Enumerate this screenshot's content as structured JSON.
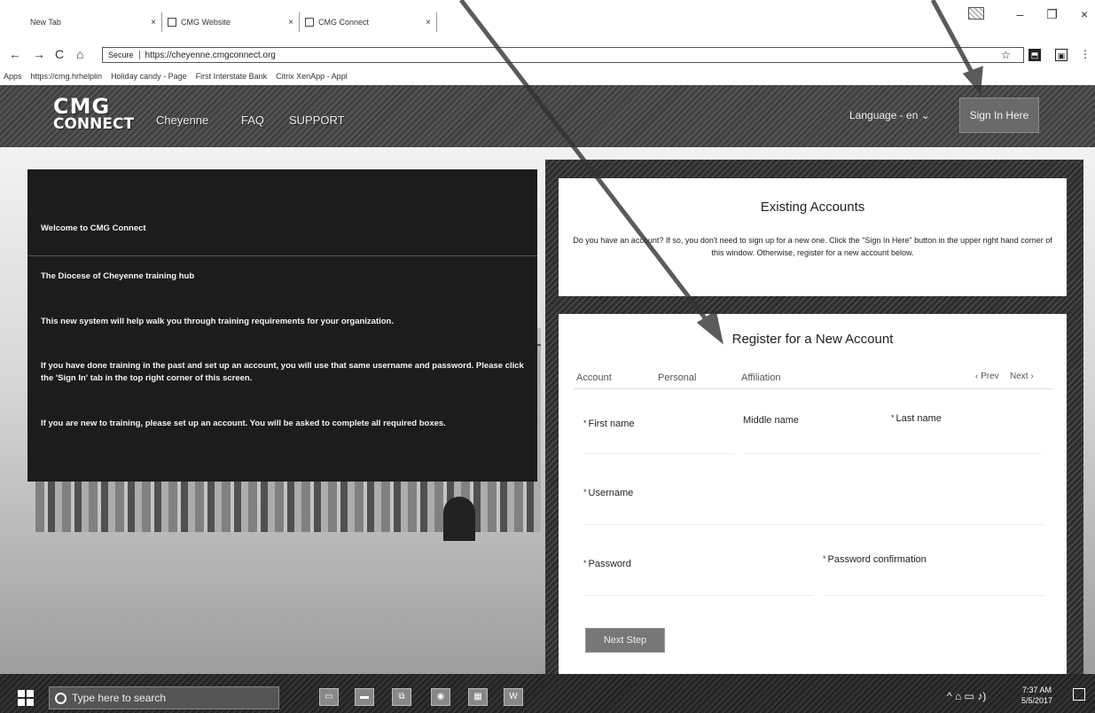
{
  "browser": {
    "tabs": [
      {
        "label": "New Tab"
      },
      {
        "label": "CMG Website"
      },
      {
        "label": "CMG Connect"
      }
    ],
    "tab_close_glyph": "×",
    "window_controls": {
      "minimize": "–",
      "maximize": "❐",
      "close": "×"
    },
    "nav": {
      "back": "←",
      "forward": "→",
      "reload": "C",
      "home": "⌂"
    },
    "address": {
      "secure_label": "Secure",
      "url": "https://cheyenne.cmgconnect.org"
    },
    "star_glyph": "☆",
    "ext1": "⬒",
    "ext2": "▣",
    "menu_glyph": "⋮",
    "bookmarks": [
      {
        "label": "Apps"
      },
      {
        "label": "https://cmg.hrhelplin"
      },
      {
        "label": "Holiday candy - Page"
      },
      {
        "label": "First Interstate Bank"
      },
      {
        "label": "Citrix XenApp - Appl"
      }
    ]
  },
  "header": {
    "logo_line1": "CMG",
    "logo_line2": "CONNECT",
    "nav": [
      {
        "label": "Cheyenne"
      },
      {
        "label": "FAQ"
      },
      {
        "label": "SUPPORT"
      }
    ],
    "language": "Language - en ⌄",
    "signin_label": "Sign In Here"
  },
  "welcome": {
    "title": "Welcome to CMG Connect",
    "subtitle": "The Diocese of Cheyenne training hub",
    "p1": "This new system will help walk you through training requirements for your organization.",
    "p2": "If you have done training in the past and set up an account, you will use that same username and password.  Please click the 'Sign In' tab in the top right corner of this screen.",
    "p3": "If you are new to training, please set up an account.  You will be asked to complete all required boxes."
  },
  "existing": {
    "title": "Existing Accounts",
    "text": "Do you have an account? If so, you don't need to sign up for a new one. Click the \"Sign In Here\" button in the upper right hand corner of this window. Otherwise, register for a new account below."
  },
  "register": {
    "title": "Register for a New Account",
    "steps": [
      {
        "label": "Account"
      },
      {
        "label": "Personal"
      },
      {
        "label": "Affiliation"
      }
    ],
    "prev": "‹ Prev",
    "next": "Next ›",
    "required_mark": "*",
    "fields": {
      "first_name": "First name",
      "middle_name": "Middle name",
      "last_name": "Last name",
      "username": "Username",
      "password": "Password",
      "password_confirmation": "Password confirmation"
    },
    "next_step": "Next Step"
  },
  "taskbar": {
    "search_placeholder": "Type here to search",
    "apps": [
      {
        "label": "▭"
      },
      {
        "label": "▬"
      },
      {
        "label": "⧉"
      },
      {
        "label": "◉"
      },
      {
        "label": "▦"
      },
      {
        "label": "W"
      }
    ],
    "tray": "^ ⌂ ▭ ♪)",
    "time": "7:37 AM",
    "date": "5/5/2017"
  },
  "colors": {
    "header_bg": "#4a4a4a",
    "welcome_bg": "#1c1c1c",
    "panel_bg": "#ffffff",
    "button_bg": "#777777"
  }
}
